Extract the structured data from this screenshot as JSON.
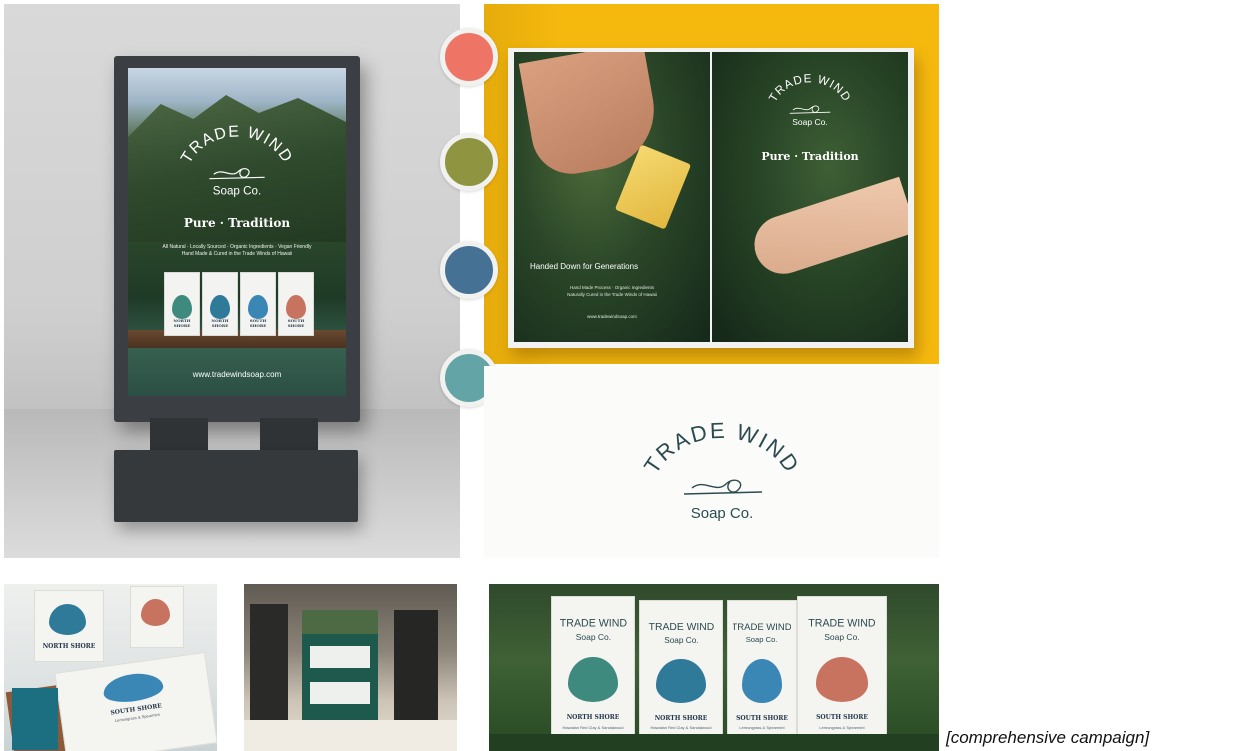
{
  "colors": {
    "swatch_coral": "#ee7566",
    "swatch_olive": "#8f9441",
    "swatch_blue": "#457194",
    "swatch_teal": "#63a5a6",
    "magazine_yellow": "#f5b90e",
    "logo_ink": "#2c4b4f"
  },
  "brand": {
    "logo_line1": "TRADE WIND",
    "logo_line2": "Soap Co."
  },
  "billboard": {
    "headline": "Pure · Tradition",
    "subline_1": "All Natural · Locally Sourced · Organic Ingredients · Vegan Friendly",
    "subline_2": "Hand Made & Cured in the Trade Winds of Hawaii",
    "url": "www.tradewindsoap.com"
  },
  "magazine": {
    "headline": "Pure · Tradition",
    "tagline": "Handed Down for Generations",
    "subline_1": "Hand Made Process · Organic Ingredients",
    "subline_2": "Naturally Cured in the Trade Winds of Hawaii",
    "url": "www.tradewindsoap.com"
  },
  "products": [
    {
      "name": "NORTH SHORE",
      "scent": "Hawaiian Red Clay & Sandalwood"
    },
    {
      "name": "NORTH SHORE",
      "scent": "Hawaiian Red Clay & Sandalwood"
    },
    {
      "name": "SOUTH SHORE",
      "scent": "Lemongrass & Spearmint"
    },
    {
      "name": "SOUTH SHORE",
      "scent": "Lemongrass & Spearmint"
    }
  ],
  "caption": "[comprehensive campaign]",
  "icons": [
    "trade-wind-logo-icon",
    "swirl-icon",
    "leaf-icon"
  ]
}
